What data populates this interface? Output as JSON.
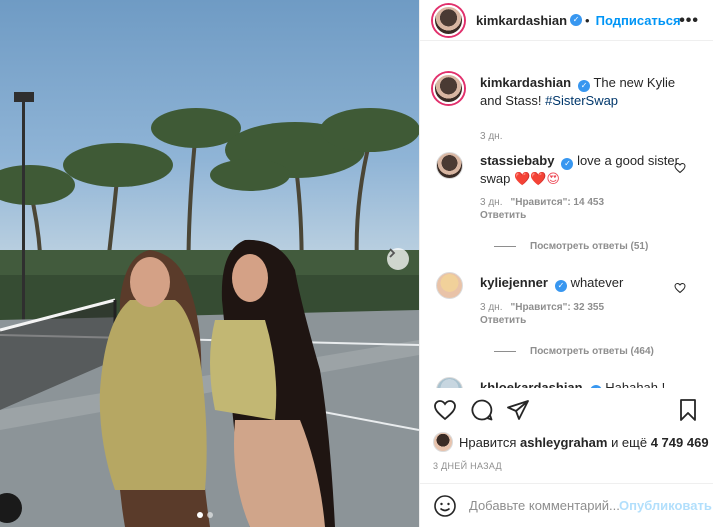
{
  "post": {
    "author": "kimkardashian",
    "follow_label": "Подписаться",
    "separator": "•",
    "more": "•••"
  },
  "caption": {
    "username": "kimkardashian",
    "text": "The new Kylie and Stass!",
    "hashtag": "#SisterSwap",
    "time": "3 дн."
  },
  "comments": [
    {
      "username": "stassiebaby",
      "text": "love a good sister swap",
      "emojis": "❤️❤️😍",
      "time": "3 дн.",
      "likes": "\"Нравится\": 14 453",
      "reply": "Ответить",
      "view_replies": "Посмотреть ответы (51)"
    },
    {
      "username": "kyliejenner",
      "text": "whatever",
      "time": "3 дн.",
      "likes": "\"Нравится\": 32 355",
      "reply": "Ответить",
      "view_replies": "Посмотреть ответы (464)"
    },
    {
      "username": "khloekardashian",
      "text": "Hahahah !"
    }
  ],
  "likes": {
    "prefix": "Нравится",
    "user": "ashleygraham",
    "middle": "и ещё",
    "count": "4 749 469"
  },
  "date": "3 ДНЕЙ НАЗАД",
  "composer": {
    "placeholder": "Добавьте комментарий...",
    "publish": "Опубликовать"
  },
  "colors": {
    "accent": "#0095f6",
    "verified": "#3897f0",
    "muted": "#8e8e8e",
    "heart_red": "#ed4956"
  }
}
